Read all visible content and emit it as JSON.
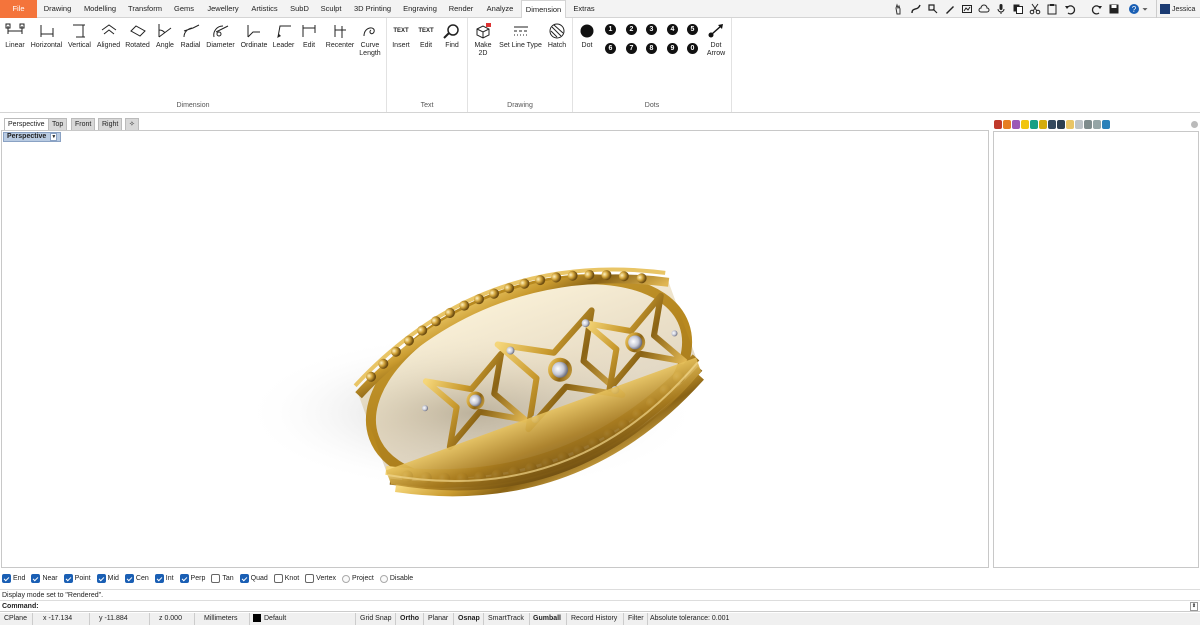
{
  "menu": {
    "file": "File",
    "tabs": [
      "Drawing",
      "Modelling",
      "Transform",
      "Gems",
      "Jewellery",
      "Artistics",
      "SubD",
      "Sculpt",
      "3D Printing",
      "Engraving",
      "Render",
      "Analyze",
      "Dimension",
      "Extras"
    ],
    "active": "Dimension",
    "user": "Jessica"
  },
  "ribbon": {
    "groups": {
      "dimension": "Dimension",
      "text": "Text",
      "drawing": "Drawing",
      "dots": "Dots"
    },
    "dimension_buttons": [
      "Linear",
      "Horizontal",
      "Vertical",
      "Aligned",
      "Rotated",
      "Angle",
      "Radial",
      "Diameter",
      "Ordinate",
      "Leader",
      "Edit",
      "Recenter",
      "Curve\nLength"
    ],
    "text_buttons": [
      "Insert",
      "Edit",
      "Find"
    ],
    "text_icon_labels": [
      "TEXT",
      "TEXT"
    ],
    "drawing_buttons": [
      "Make\n2D",
      "Set Line Type",
      "Hatch"
    ],
    "dots_buttons": [
      "Dot",
      "Dot\nArrow"
    ],
    "dot_numbers": [
      "1",
      "2",
      "3",
      "4",
      "5",
      "6",
      "7",
      "8",
      "9",
      "0"
    ]
  },
  "viewport": {
    "tabs": [
      "Perspective",
      "Top",
      "Front",
      "Right"
    ],
    "active_label": "Perspective"
  },
  "osnap": [
    {
      "label": "End",
      "on": true
    },
    {
      "label": "Near",
      "on": true
    },
    {
      "label": "Point",
      "on": true
    },
    {
      "label": "Mid",
      "on": true
    },
    {
      "label": "Cen",
      "on": true
    },
    {
      "label": "Int",
      "on": true
    },
    {
      "label": "Perp",
      "on": true
    },
    {
      "label": "Tan",
      "on": false
    },
    {
      "label": "Quad",
      "on": true
    },
    {
      "label": "Knot",
      "on": false
    },
    {
      "label": "Vertex",
      "on": false
    },
    {
      "label": "Project",
      "radio": true
    },
    {
      "label": "Disable",
      "radio": true
    }
  ],
  "command": {
    "history": "Display mode set to \"Rendered\".",
    "prompt": "Command:"
  },
  "status": {
    "cplane": "CPlane",
    "x": "x -17.134",
    "y": "y -11.884",
    "z": "z 0.000",
    "units": "Millimeters",
    "layer": "Default",
    "grid_snap": "Grid Snap",
    "ortho": "Ortho",
    "planar": "Planar",
    "osnap": "Osnap",
    "smarttrack": "SmartTrack",
    "gumball": "Gumball",
    "record_history": "Record History",
    "filter": "Filter",
    "tolerance": "Absolute tolerance: 0.001"
  },
  "colors": {
    "file_tab": "#f4743b",
    "gold": "#c99a2e",
    "viewport_label": "#b9cbe2",
    "check": "#1a5fb4"
  }
}
